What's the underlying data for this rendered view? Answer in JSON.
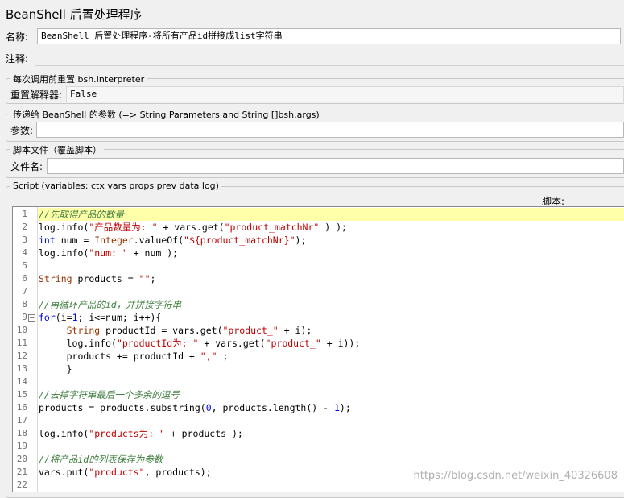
{
  "window": {
    "title": "BeanShell 后置处理程序"
  },
  "form": {
    "name_label": "名称:",
    "name_value": "BeanShell 后置处理程序-将所有产品id拼接成list字符串",
    "comment_label": "注释:",
    "comment_value": ""
  },
  "reset_group": {
    "legend": "每次调用前重置 bsh.Interpreter",
    "label": "重置解释器:",
    "value": "False"
  },
  "params_group": {
    "legend": "传递给 BeanShell 的参数 (=> String Parameters and String []bsh.args)",
    "label": "参数:",
    "value": ""
  },
  "file_group": {
    "legend": "脚本文件（覆盖脚本）",
    "label": "文件名:",
    "value": ""
  },
  "script_group": {
    "legend": "Script (variables: ctx vars props prev data log)",
    "label": "脚本:"
  },
  "code_lines": [
    "//先取得产品的数量",
    "log.info(\"产品数量为: \" + vars.get(\"product_matchNr\" ) );",
    "int num = Integer.valueOf(\"${product_matchNr}\");",
    "log.info(\"num: \" + num );",
    "",
    "String products = \"\";",
    "",
    "//再循环产品的id，并拼接字符串",
    "for(i=1; i<=num; i++){",
    "     String productId = vars.get(\"product_\" + i);",
    "     log.info(\"productId为: \" + vars.get(\"product_\" + i));",
    "     products += productId + \",\" ;",
    "     }",
    "",
    "//去掉字符串最后一个多余的逗号",
    "products = products.substring(0, products.length() - 1);",
    "",
    "log.info(\"products为: \" + products );",
    "",
    "//将产品id的列表保存为参数",
    "vars.put(\"products\", products);",
    ""
  ],
  "line_numbers": [
    "1",
    "2",
    "3",
    "4",
    "5",
    "6",
    "7",
    "8",
    "9",
    "10",
    "11",
    "12",
    "13",
    "14",
    "15",
    "16",
    "17",
    "18",
    "19",
    "20",
    "21",
    "22"
  ],
  "highlighted_line": 1,
  "fold_line": 9,
  "fold_glyph": "−",
  "watermark": "https://blog.csdn.net/weixin_40326608",
  "colors": {
    "background": "#f0f0f0",
    "comment": "#3f7f3f",
    "string": "#c00000",
    "keyword": "#0000ff",
    "type": "#993300",
    "current_line": "#ffffaa"
  }
}
